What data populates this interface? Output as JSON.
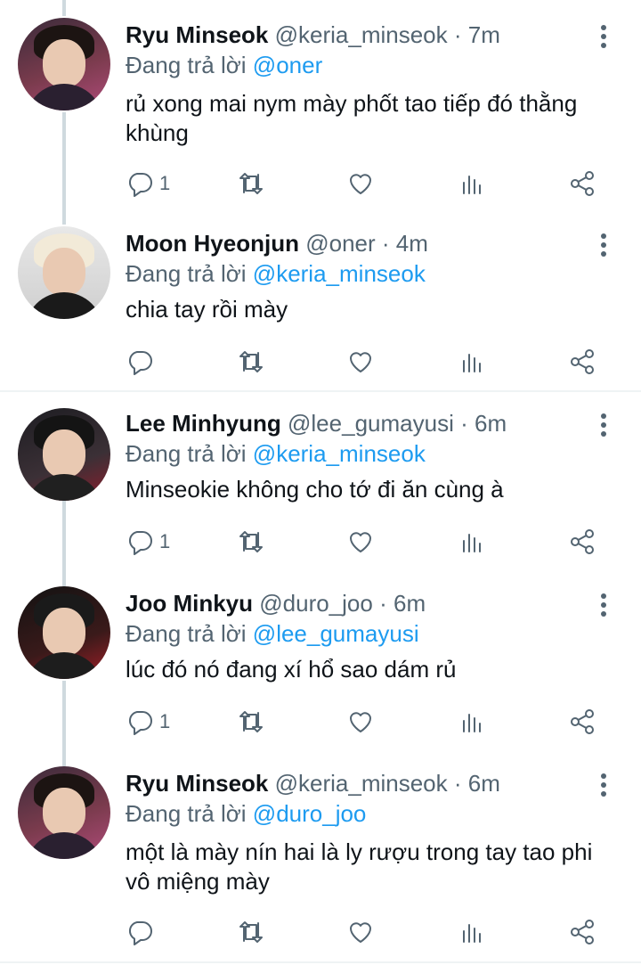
{
  "tweets": [
    {
      "name": "Ryu Minseok",
      "handle": "@keria_minseok",
      "sep": "·",
      "time": "7m",
      "replying_prefix": "Đang trả lời",
      "replying_to": "@oner",
      "text": "rủ xong mai nym mày phốt tao tiếp đó thằng khùng",
      "reply_count": "1",
      "avatar_icon": "profile-photo"
    },
    {
      "name": "Moon Hyeonjun",
      "handle": "@oner",
      "sep": "·",
      "time": "4m",
      "replying_prefix": "Đang trả lời",
      "replying_to": "@keria_minseok",
      "text": "chia tay rồi mày",
      "reply_count": "",
      "avatar_icon": "profile-photo"
    },
    {
      "name": "Lee Minhyung",
      "handle": "@lee_gumayusi",
      "sep": "·",
      "time": "6m",
      "replying_prefix": "Đang trả lời",
      "replying_to": "@keria_minseok",
      "text": "Minseokie không cho tớ đi ăn cùng à",
      "reply_count": "1",
      "avatar_icon": "profile-photo"
    },
    {
      "name": "Joo Minkyu",
      "handle": "@duro_joo",
      "sep": "·",
      "time": "6m",
      "replying_prefix": "Đang trả lời",
      "replying_to": "@lee_gumayusi",
      "text": "lúc đó nó đang xí hổ sao dám rủ",
      "reply_count": "1",
      "avatar_icon": "profile-photo"
    },
    {
      "name": "Ryu Minseok",
      "handle": "@keria_minseok",
      "sep": "·",
      "time": "6m",
      "replying_prefix": "Đang trả lời",
      "replying_to": "@duro_joo",
      "text": "một là mày nín hai là ly rượu trong tay tao phi vô miệng mày",
      "reply_count": "",
      "avatar_icon": "profile-photo"
    }
  ],
  "colors": {
    "link": "#1d9bf0",
    "secondary_text": "#536471",
    "primary_text": "#0f1419",
    "thread_line": "#cfd9de"
  },
  "icons": [
    "reply-icon",
    "retweet-icon",
    "like-icon",
    "views-icon",
    "share-icon",
    "more-icon"
  ]
}
